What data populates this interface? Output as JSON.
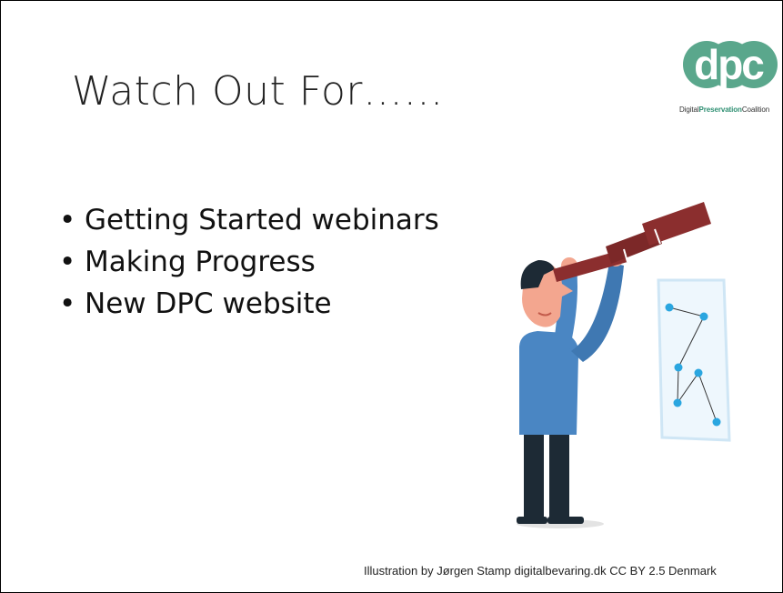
{
  "slide": {
    "title": "Watch Out For……",
    "bullets": [
      "Getting Started webinars",
      "Making Progress",
      "New DPC website"
    ],
    "logo": {
      "mark": "dpc",
      "text_pre": "Digital",
      "text_bold": "Preservation",
      "text_post": "Coalition"
    },
    "credit": "Illustration by Jørgen Stamp digitalbevaring.dk CC BY 2.5 Denmark"
  },
  "colors": {
    "logo_green": "#5aa78c",
    "telescope": "#8b2e2e",
    "shirt": "#4a86c3",
    "pants": "#1d2a35",
    "dots": "#2aa6e0"
  },
  "icons": {
    "illustration": "man-with-telescope-icon",
    "logo": "dpc-logo-icon"
  }
}
